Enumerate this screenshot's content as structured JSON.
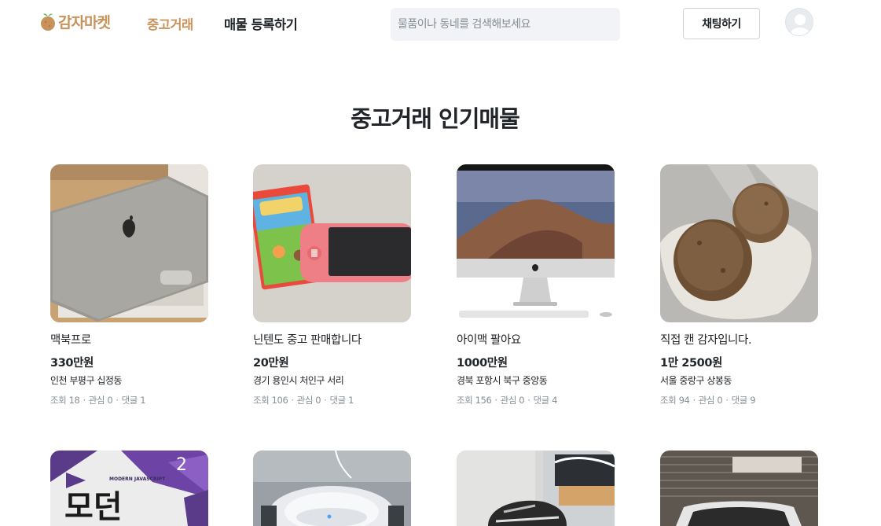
{
  "header": {
    "logo_text": "감자마켓",
    "nav": [
      "중고거래",
      "매물 등록하기"
    ],
    "search_placeholder": "물품이나 동네를 검색해보세요",
    "chat_label": "채팅하기"
  },
  "main": {
    "title": "중고거래 인기매물",
    "count_labels": {
      "views": "조회",
      "likes": "관심",
      "comments": "댓글"
    },
    "items": [
      {
        "title": "맥북프로",
        "price": "330만원",
        "region": "인천 부평구 십정동",
        "views": "18",
        "likes": "0",
        "comments": "1"
      },
      {
        "title": "닌텐도 중고 판매합니다",
        "price": "20만원",
        "region": "경기 용인시 처인구 서리",
        "views": "106",
        "likes": "0",
        "comments": "1"
      },
      {
        "title": "아이맥 팔아요",
        "price": "1000만원",
        "region": "경북 포항시 북구 중앙동",
        "views": "156",
        "likes": "0",
        "comments": "4"
      },
      {
        "title": "직접 캔 감자입니다.",
        "price": "1만 2500원",
        "region": "서울 중랑구 상봉동",
        "views": "94",
        "likes": "0",
        "comments": "9"
      }
    ],
    "book_cover": {
      "heading": "MODERN JAVASCRIPT",
      "big_text": "모던",
      "number": "2"
    }
  },
  "colors": {
    "accent": "#c8935a",
    "text": "#212529",
    "muted": "#868e96",
    "search_bg": "#f2f3f6"
  }
}
